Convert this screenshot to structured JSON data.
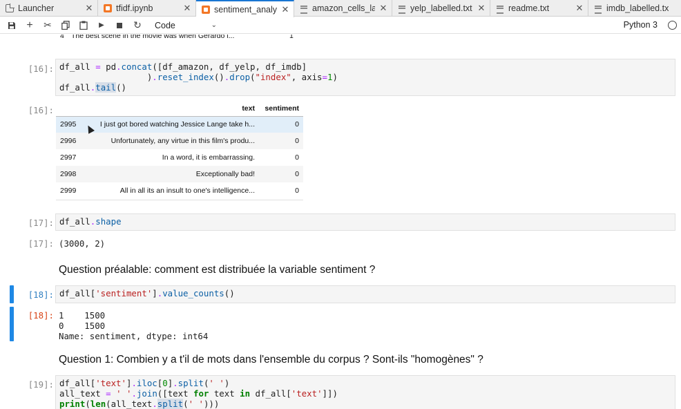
{
  "tabs": [
    {
      "label": "Launcher",
      "icon": "launcher-icon",
      "active": false
    },
    {
      "label": "tfidf.ipynb",
      "icon": "notebook-icon",
      "active": false
    },
    {
      "label": "sentiment_analys",
      "icon": "notebook-icon",
      "active": true
    },
    {
      "label": "amazon_cells_la",
      "icon": "text-file-icon",
      "active": false
    },
    {
      "label": "yelp_labelled.txt",
      "icon": "text-file-icon",
      "active": false
    },
    {
      "label": "readme.txt",
      "icon": "text-file-icon",
      "active": false
    },
    {
      "label": "imdb_labelled.tx",
      "icon": "text-file-icon",
      "active": false
    }
  ],
  "toolbar": {
    "cell_type": "Code",
    "kernel": "Python 3"
  },
  "notebook": {
    "prev_output_row": {
      "index": "4",
      "text": "The best scene in the movie was when Gerardo i...",
      "sentiment": "1"
    },
    "cell16": {
      "in_prompt": "[16]:",
      "out_prompt": "[16]:",
      "columns": [
        "text",
        "sentiment"
      ],
      "rows": [
        {
          "index": "2995",
          "text": "I just got bored watching Jessice Lange take h...",
          "sentiment": "0"
        },
        {
          "index": "2996",
          "text": "Unfortunately, any virtue in this film's produ...",
          "sentiment": "0"
        },
        {
          "index": "2997",
          "text": "In a word, it is embarrassing.",
          "sentiment": "0"
        },
        {
          "index": "2998",
          "text": "Exceptionally bad!",
          "sentiment": "0"
        },
        {
          "index": "2999",
          "text": "All in all its an insult to one's intelligence...",
          "sentiment": "0"
        }
      ]
    },
    "cell17": {
      "in_prompt": "[17]:",
      "out_prompt": "[17]:",
      "output": "(3000, 2)"
    },
    "md1": "Question préalable: comment est distribuée la variable sentiment ?",
    "cell18": {
      "in_prompt": "[18]:",
      "out_prompt": "[18]:",
      "output": "1    1500\n0    1500\nName: sentiment, dtype: int64"
    },
    "md2": "Question 1: Combien y a t'il de mots dans l'ensemble du corpus ? Sont-ils \"homogènes\" ?",
    "cell19": {
      "in_prompt": "[19]:"
    }
  }
}
